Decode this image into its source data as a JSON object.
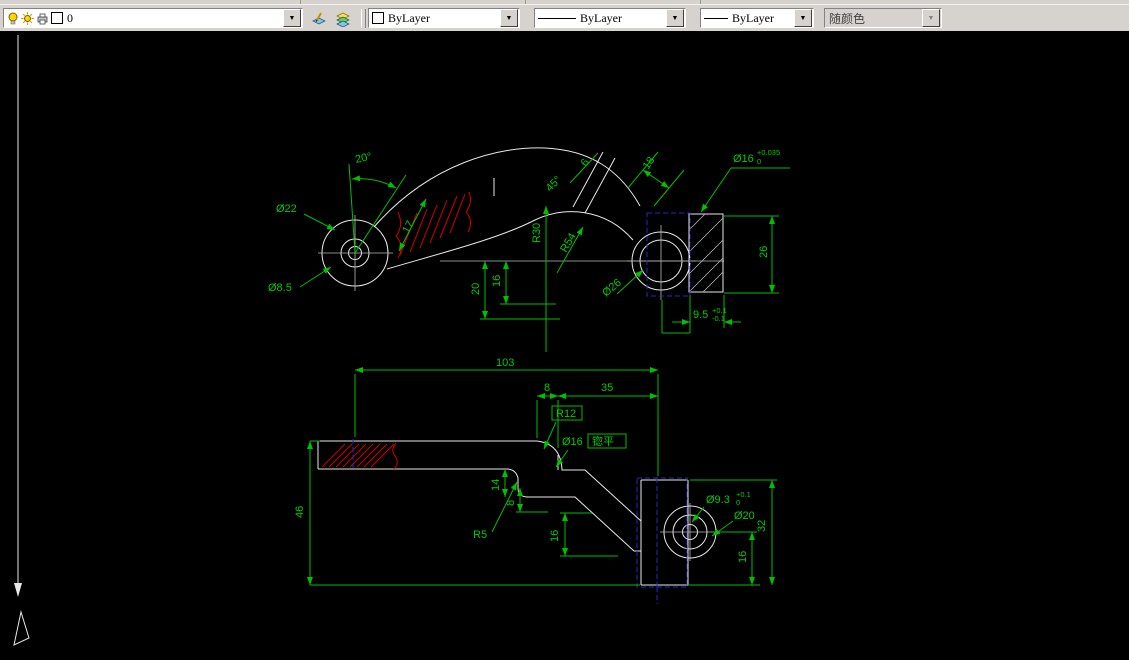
{
  "toolbar": {
    "layer_combo": {
      "value": "0"
    },
    "color_combo": {
      "value": "ByLayer"
    },
    "linetype_combo": {
      "value": "ByLayer"
    },
    "lineweight_combo": {
      "value": "ByLayer"
    },
    "plotstyle_combo": {
      "value": "随颜色"
    },
    "icons": [
      "layer-on-bulb-icon",
      "layer-freeze-sun-icon",
      "layer-plot-printer-icon",
      "layer-color-swatch-icon",
      "make-object-layer-current-icon",
      "layer-previous-icon"
    ]
  },
  "colors": {
    "dimension_green": "#00c000",
    "hatch_red": "#d40000",
    "phantom_blue": "#2828cc",
    "outline_white": "#e8e8e8",
    "toolbar_gray": "#d6d3ce"
  },
  "drawing": {
    "top_view": {
      "angle_20": "20°",
      "dia_22": "Ø22",
      "dia_8_5": "Ø8.5",
      "len_17": "17",
      "r30": "R30",
      "r54": "R54",
      "angle_45": "45°",
      "len_6": "6",
      "len_18": "18",
      "dia_16": "Ø16",
      "dia_16_tol_up": "+0.035",
      "dia_16_tol_dn": "0",
      "len_26": "26",
      "len_16": "16",
      "len_20": "20",
      "dia_26": "Ø26",
      "len_9_5": "9.5",
      "len_9_5_tol_up": "+0.1",
      "len_9_5_tol_dn": "-0.1"
    },
    "front_view": {
      "len_103": "103",
      "len_8_top": "8",
      "len_35": "35",
      "r12": "R12",
      "dia_16_label": "Ø16",
      "spotface_label": "锪平",
      "len_14": "14",
      "len_8_side": "8",
      "r5": "R5",
      "len_16_mid": "16",
      "len_46": "46",
      "dia_9_3": "Ø9.3",
      "dia_9_3_tol_up": "+0.1",
      "dia_9_3_tol_dn": "0",
      "dia_20": "Ø20",
      "len_16_right": "16",
      "len_32": "32"
    }
  }
}
